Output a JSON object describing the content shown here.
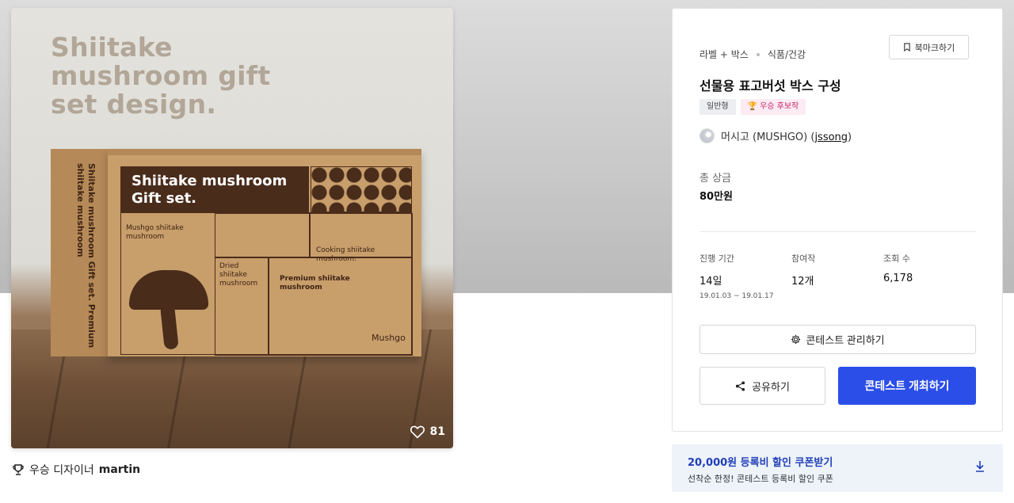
{
  "hero": {
    "image_title": "Shiitake mushroom gift set design.",
    "box_band": "Shiitake mushroom Gift set.",
    "box_side": "Shiitake mushroom Gift set. Premium shiitake mushroom",
    "box_labels": {
      "mushgo": "Mushgo shiitake mushroom",
      "cooking": "Cooking shiitake mushroom.",
      "dried": "Dried shiitake mushroom",
      "premium": "Premium shiitake mushroom",
      "brand": "Mushgo"
    },
    "likes_count": "81"
  },
  "winner": {
    "label": "우승 디자이너",
    "name": "martin"
  },
  "card": {
    "breadcrumb": [
      "라벨 + 박스",
      "식품/건강"
    ],
    "bookmark_label": "북마크하기",
    "title": "선물용 표고버섯 박스 구성",
    "tags": {
      "type": "일반형",
      "award": "우승 후보작"
    },
    "owner": {
      "name": "머시고 (MUSHGO) (",
      "handle": "jssong",
      "close": ")"
    },
    "prize": {
      "label": "총 상금",
      "value": "80만원"
    },
    "stats": {
      "period": {
        "label": "진행 기간",
        "value": "14일",
        "range": "19.01.03 ~ 19.01.17"
      },
      "entries": {
        "label": "참여작",
        "value": "12개"
      },
      "views": {
        "label": "조회 수",
        "value": "6,178"
      }
    },
    "manage_label": "콘테스트 관리하기",
    "share_label": "공유하기",
    "host_label": "콘테스트 개최하기"
  },
  "coupon": {
    "title": "20,000원 등록비 할인 쿠폰받기",
    "subtitle": "선착순 한정! 콘테스트 등록비 할인 쿠폰"
  },
  "colors": {
    "accent": "#2b4de8",
    "coupon_text": "#1f3fb8",
    "award_tag": "#c4266e"
  },
  "icons": [
    "heart-icon",
    "trophy-icon",
    "bookmark-icon",
    "gear-icon",
    "share-icon",
    "download-icon"
  ]
}
